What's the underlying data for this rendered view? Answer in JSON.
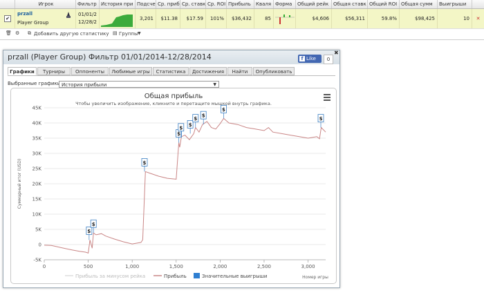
{
  "grid": {
    "headers": [
      "Игрок",
      "Фильтр",
      "История при",
      "Подсчет",
      "Ср. приб",
      "Ср. ставк",
      "Ср. ROI",
      "Прибыль",
      "Кваля",
      "Форма",
      "Общий рейк",
      "Общая ставк",
      "Общий ROI",
      "Общая сумм",
      "Выигрыши"
    ],
    "row": {
      "name": "przall",
      "group": "Player Group",
      "filter_line1": "01/01/2",
      "filter_line2": "12/28/2",
      "count": "3,201",
      "avg_profit": "$11.38",
      "avg_stake": "$17.59",
      "avg_roi": "101%",
      "profit": "$36,432",
      "qual": "85",
      "total_rake": "$4,606",
      "total_stake": "$56,311",
      "total_roi": "59.8%",
      "total_sum": "$98,425",
      "wins": "10"
    },
    "toolbar": {
      "add_stat": "Добавить другую статистику",
      "groups": "Группы"
    }
  },
  "panel": {
    "title": "przall (Player Group) Фильтр 01/01/2014-12/28/2014",
    "like_label": "Like",
    "like_count": "0",
    "tabs": [
      "Графики",
      "Турниры",
      "Оппоненты",
      "Любимые игры",
      "Статистика",
      "Достижения",
      "Найти",
      "Опубликовать"
    ],
    "select_label": "Выбранные графики:",
    "select_value": "История прибыли"
  },
  "chart_data": {
    "type": "line",
    "title": "Общая прибыль",
    "subtitle": "Чтобы увеличить изображение, кликните и перетащите мышкой внутрь графика.",
    "ylabel": "Суммарный итог (USD)",
    "xlabel": "Номер игры",
    "ylim": [
      -5000,
      45000
    ],
    "xlim": [
      0,
      3200
    ],
    "yticks": [
      "-5K",
      "0",
      "5K",
      "10K",
      "15K",
      "20K",
      "25K",
      "30K",
      "35K",
      "40K",
      "45K"
    ],
    "xticks": [
      "0",
      "500",
      "1,000",
      "1,500",
      "2,000",
      "2,500",
      "3,000"
    ],
    "legend": [
      "Прибыль за минусом рейка",
      "Прибыль",
      "Значительные выигрыши"
    ],
    "flag_symbol": "$",
    "series": [
      {
        "name": "Прибыль",
        "x": [
          0,
          80,
          160,
          240,
          320,
          400,
          470,
          500,
          520,
          545,
          560,
          590,
          650,
          700,
          800,
          900,
          1000,
          1100,
          1120,
          1150,
          1200,
          1300,
          1400,
          1500,
          1530,
          1540,
          1560,
          1600,
          1650,
          1700,
          1720,
          1760,
          1800,
          1850,
          1900,
          1950,
          2000,
          2040,
          2100,
          2200,
          2300,
          2400,
          2500,
          2550,
          2600,
          2700,
          2800,
          2900,
          3000,
          3100,
          3130,
          3150,
          3200
        ],
        "y": [
          -200,
          -300,
          -800,
          -1300,
          -1800,
          -2200,
          -2500,
          -2800,
          1500,
          -1200,
          3800,
          3200,
          3600,
          2800,
          1800,
          900,
          200,
          700,
          1600,
          24000,
          23500,
          22500,
          21800,
          21500,
          33500,
          32000,
          35500,
          36000,
          34500,
          36500,
          38500,
          37000,
          39500,
          40500,
          38500,
          38000,
          39800,
          41500,
          40000,
          39500,
          38500,
          38000,
          37500,
          38500,
          37000,
          36500,
          36000,
          35500,
          35000,
          35500,
          34800,
          38500,
          37000
        ]
      },
      {
        "name": "Прибыль за минусом рейка",
        "x": [],
        "y": []
      }
    ],
    "flags": [
      {
        "x": 510,
        "y": 1500
      },
      {
        "x": 560,
        "y": 3800
      },
      {
        "x": 1140,
        "y": 24000
      },
      {
        "x": 1530,
        "y": 33500
      },
      {
        "x": 1555,
        "y": 35500
      },
      {
        "x": 1660,
        "y": 36500
      },
      {
        "x": 1720,
        "y": 38500
      },
      {
        "x": 1810,
        "y": 39500
      },
      {
        "x": 2040,
        "y": 41500
      },
      {
        "x": 3145,
        "y": 38500
      }
    ]
  }
}
